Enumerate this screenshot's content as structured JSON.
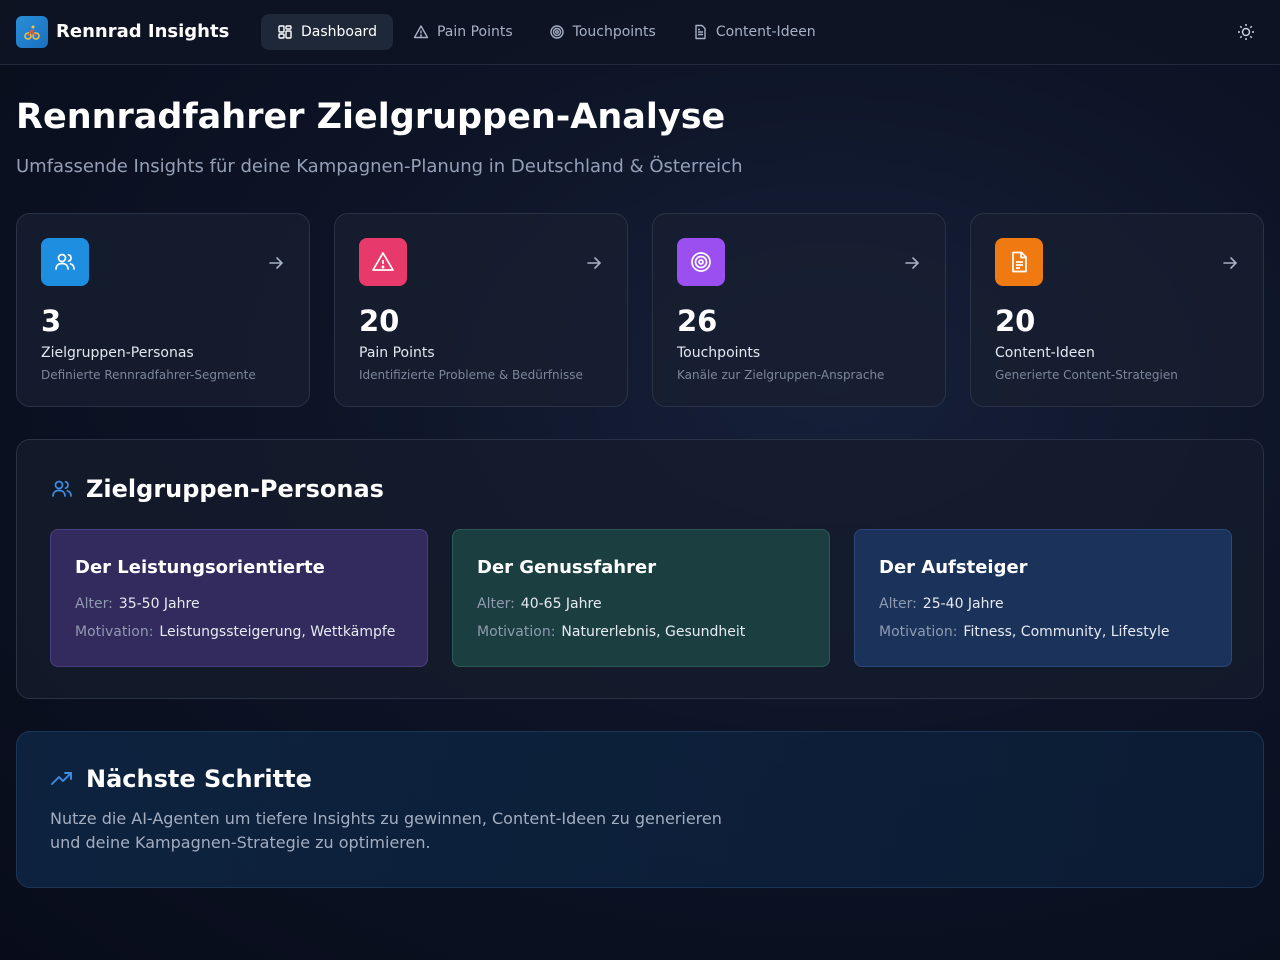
{
  "header": {
    "brand": "Rennrad Insights",
    "logo_icon": "cyclist-icon",
    "nav": [
      {
        "label": "Dashboard",
        "icon": "grid-icon",
        "active": true
      },
      {
        "label": "Pain Points",
        "icon": "warning-icon",
        "active": false
      },
      {
        "label": "Touchpoints",
        "icon": "target-icon",
        "active": false
      },
      {
        "label": "Content-Ideen",
        "icon": "document-icon",
        "active": false
      }
    ],
    "theme_icon": "sun-icon"
  },
  "page": {
    "title": "Rennradfahrer Zielgruppen-Analyse",
    "subtitle": "Umfassende Insights für deine Kampagnen-Planung in Deutschland & Österreich"
  },
  "stats": [
    {
      "value": "3",
      "label": "Zielgruppen-Personas",
      "desc": "Definierte Rennradfahrer-Segmente",
      "icon": "users-icon",
      "color": "#1e8fe0"
    },
    {
      "value": "20",
      "label": "Pain Points",
      "desc": "Identifizierte Probleme & Bedürfnisse",
      "icon": "warning-icon",
      "color": "#e83a6a"
    },
    {
      "value": "26",
      "label": "Touchpoints",
      "desc": "Kanäle zur Zielgruppen-Ansprache",
      "icon": "target-icon",
      "color": "#9b4ff0"
    },
    {
      "value": "20",
      "label": "Content-Ideen",
      "desc": "Generierte Content-Strategien",
      "icon": "document-icon",
      "color": "#f07a12"
    }
  ],
  "personas": {
    "title": "Zielgruppen-Personas",
    "age_label": "Alter:",
    "motivation_label": "Motivation:",
    "items": [
      {
        "name": "Der Leistungsorientierte",
        "age": "35-50 Jahre",
        "motivation": "Leistungssteigerung, Wettkämpfe"
      },
      {
        "name": "Der Genussfahrer",
        "age": "40-65 Jahre",
        "motivation": "Naturerlebnis, Gesundheit"
      },
      {
        "name": "Der Aufsteiger",
        "age": "25-40 Jahre",
        "motivation": "Fitness, Community, Lifestyle"
      }
    ]
  },
  "next_steps": {
    "title": "Nächste Schritte",
    "text": "Nutze die AI-Agenten um tiefere Insights zu gewinnen, Content-Ideen zu generieren und deine Kampagnen-Strategie zu optimieren."
  },
  "colors": {
    "accent": "#3b8fe6",
    "trend": "#3b8fe6"
  }
}
